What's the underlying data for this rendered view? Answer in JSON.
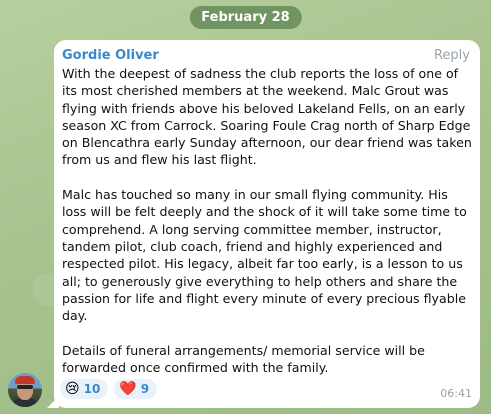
{
  "date_label": "February 28",
  "message": {
    "sender": "Gordie Oliver",
    "reply_label": "Reply",
    "paragraphs": [
      "With the deepest of sadness the club reports the loss of one of its most cherished members at the weekend. Malc Grout was flying with friends above his beloved Lakeland Fells, on an early season XC from Carrock.  Soaring Foule Crag north of Sharp Edge on Blencathra early Sunday afternoon, our dear friend was taken from us and flew his last flight.",
      "Malc has touched so many in our small flying community.  His loss will be felt deeply and the shock of it will take some time to comprehend. A long serving committee member, instructor, tandem pilot, club coach, friend and highly experienced and respected pilot. His legacy, albeit far too early, is a lesson to us all; to generously give everything to help others and share the passion for life and flight every minute of every precious flyable day.",
      "Details of funeral arrangements/ memorial service will be forwarded once confirmed with the family."
    ],
    "time": "06:41",
    "reactions": [
      {
        "emoji": "😢",
        "icon": "crying-face-icon",
        "count": "10"
      },
      {
        "emoji": "❤️",
        "icon": "red-heart-icon",
        "count": "9"
      }
    ]
  },
  "colors": {
    "sender": "#3a88c9",
    "background": "#a9c590",
    "bubble": "#ffffff"
  }
}
